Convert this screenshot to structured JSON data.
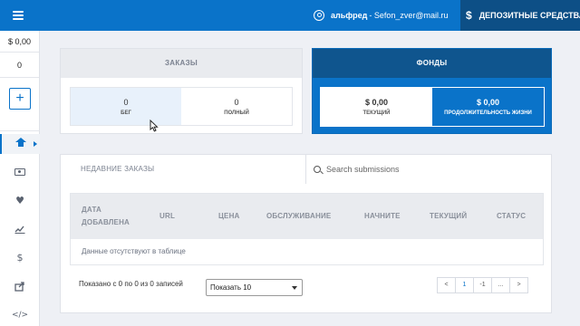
{
  "topbar": {
    "user_name": "альфред",
    "user_email": "- Sefon_zver@mail.ru",
    "deposit_icon": "$",
    "deposit_label": "ДЕПОЗИТНЫЕ СРЕДСТВА"
  },
  "sidebar": {
    "balance": "$ 0,00",
    "count": "0",
    "add_label": "+",
    "items": [
      {
        "icon": "home-icon",
        "active": true
      },
      {
        "icon": "money-icon",
        "glyph": ""
      },
      {
        "icon": "heart-icon",
        "glyph": "♥"
      },
      {
        "icon": "chart-icon",
        "glyph": ""
      },
      {
        "icon": "dollar-icon",
        "glyph": "$"
      },
      {
        "icon": "share-icon",
        "glyph": "⇪"
      },
      {
        "icon": "code-icon",
        "glyph": "</>"
      }
    ]
  },
  "orders": {
    "title": "ЗАКАЗЫ",
    "stats": [
      {
        "value": "0",
        "label": "БЕГ"
      },
      {
        "value": "0",
        "label": "ПОЛНЫЙ"
      }
    ]
  },
  "funds": {
    "title": "ФОНДЫ",
    "stats": [
      {
        "value": "$ 0,00",
        "label": "ТЕКУЩИЙ"
      },
      {
        "value": "$ 0,00",
        "label": "ПРОДОЛЖИТЕЛЬНОСТЬ ЖИЗНИ"
      }
    ]
  },
  "recent": {
    "title": "НЕДАВНИЕ ЗАКАЗЫ",
    "search_placeholder": "Search submissions",
    "columns": [
      "ДАТА ДОБАВЛЕНА",
      "URL",
      "ЦЕНА",
      "ОБСЛУЖИВАНИЕ",
      "НАЧНИТЕ",
      "ТЕКУЩИЙ",
      "СТАТУС"
    ],
    "empty_text": "Данные отсутствуют в таблице",
    "info": "Показано с 0 по 0 из 0 записей",
    "page_size": "Показать 10",
    "pager": [
      "<",
      "1",
      "-1",
      "...",
      ">"
    ]
  },
  "colors": {
    "primary": "#0a73c9",
    "primary_dark": "#0f558e",
    "header_gray": "#e9ebef"
  }
}
